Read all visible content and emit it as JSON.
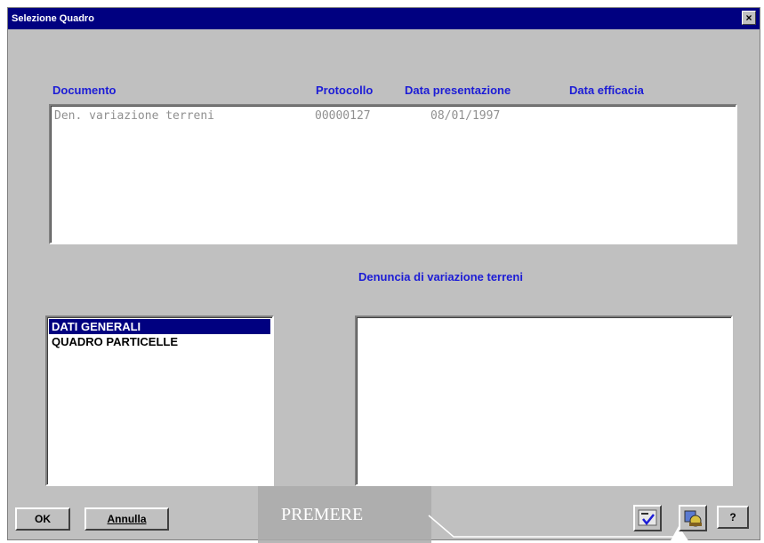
{
  "window": {
    "title": "Selezione Quadro",
    "close_glyph": "×"
  },
  "headers": {
    "documento": "Documento",
    "protocollo": "Protocollo",
    "data_presentazione": "Data presentazione",
    "data_efficacia": "Data efficacia"
  },
  "documents": [
    {
      "documento": "Den. variazione terreni",
      "protocollo": "00000127",
      "data_presentazione": "08/01/1997",
      "data_efficacia": ""
    }
  ],
  "section_label": "Denuncia di variazione terreni",
  "quadri": [
    {
      "label": "DATI GENERALI",
      "selected": true
    },
    {
      "label": "QUADRO PARTICELLE",
      "selected": false
    }
  ],
  "buttons": {
    "ok": "OK",
    "annulla": "Annulla",
    "help": "?"
  },
  "overlay": {
    "text": "PREMERE"
  },
  "icons": {
    "check": "spellcheck-icon",
    "tool": "tool-icon"
  }
}
